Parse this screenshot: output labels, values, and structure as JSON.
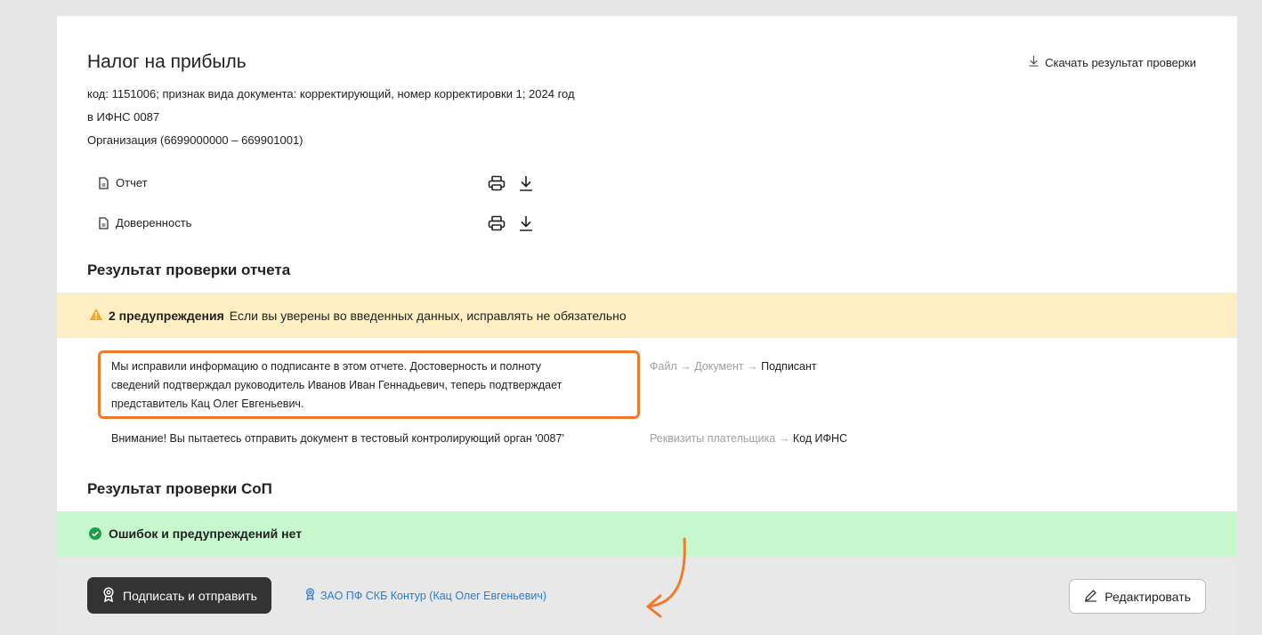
{
  "header": {
    "title": "Налог на прибыль",
    "meta_lines": [
      "код: 1151006; признак вида документа: корректирующий, номер корректировки 1; 2024 год",
      "в ИФНС 0087",
      "Организация (6699000000 – 669901001)"
    ],
    "download_label": "Скачать результат проверки"
  },
  "documents": [
    {
      "label": "Отчет",
      "icon": "document-icon"
    },
    {
      "label": "Доверенность",
      "icon": "document-icon"
    }
  ],
  "report_check": {
    "title": "Результат проверки отчета",
    "warning_count_label": "2 предупреждения",
    "warning_text": "Если вы уверены во введенных данных, исправлять не обязательно",
    "messages": [
      {
        "lines": [
          "Мы исправили информацию о подписанте в этом отчете. Достоверность и полноту",
          "сведений подтверждал руководитель Иванов Иван Геннадьевич, теперь подтверждает",
          "представитель Кац Олег Евгеньевич."
        ],
        "path": [
          "Файл",
          "Документ",
          "Подписант"
        ]
      },
      {
        "lines": [
          "Внимание! Вы пытаетесь отправить документ в тестовый контролирующий орган '0087'"
        ],
        "path": [
          "Реквизиты плательщика",
          "Код ИФНС"
        ]
      }
    ]
  },
  "sop_check": {
    "title": "Результат проверки СоП",
    "ok_text": "Ошибок и предупреждений нет"
  },
  "footer": {
    "sign_button": "Подписать и отправить",
    "certificate": "ЗАО ПФ СКБ Контур (Кац Олег Евгеньевич)",
    "edit_button": "Редактировать"
  },
  "colors": {
    "warning_bg": "#fdefc3",
    "success_bg": "#c6f7cd",
    "annotation": "#f07a2a",
    "link": "#2a7bd4"
  }
}
